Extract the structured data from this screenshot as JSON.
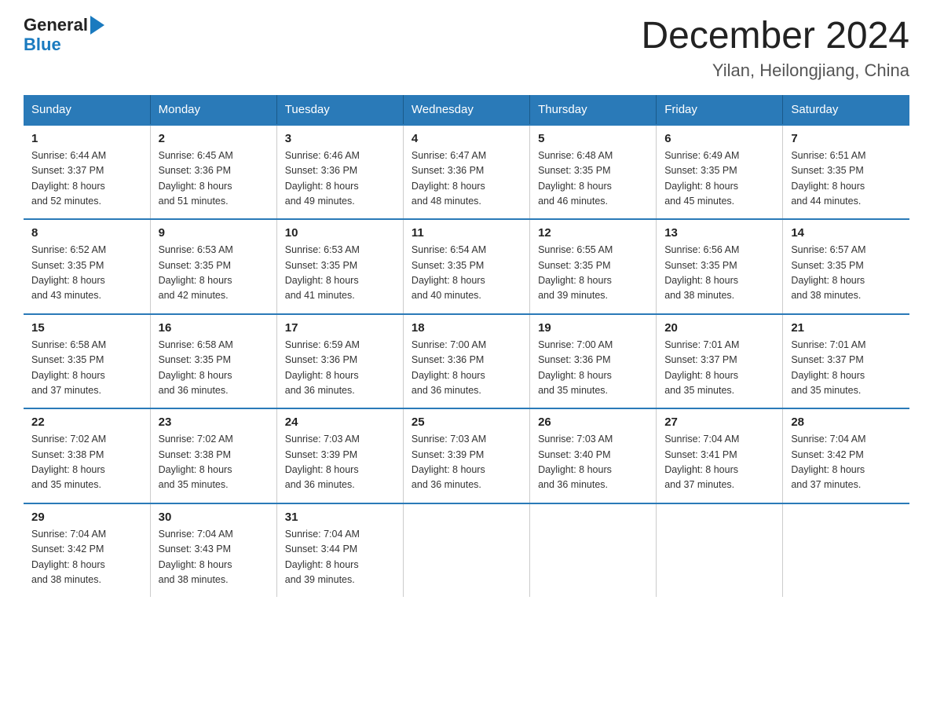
{
  "header": {
    "logo_general": "General",
    "logo_blue": "Blue",
    "title": "December 2024",
    "subtitle": "Yilan, Heilongjiang, China"
  },
  "days_of_week": [
    "Sunday",
    "Monday",
    "Tuesday",
    "Wednesday",
    "Thursday",
    "Friday",
    "Saturday"
  ],
  "weeks": [
    [
      {
        "day": "1",
        "sunrise": "6:44 AM",
        "sunset": "3:37 PM",
        "daylight": "8 hours and 52 minutes."
      },
      {
        "day": "2",
        "sunrise": "6:45 AM",
        "sunset": "3:36 PM",
        "daylight": "8 hours and 51 minutes."
      },
      {
        "day": "3",
        "sunrise": "6:46 AM",
        "sunset": "3:36 PM",
        "daylight": "8 hours and 49 minutes."
      },
      {
        "day": "4",
        "sunrise": "6:47 AM",
        "sunset": "3:36 PM",
        "daylight": "8 hours and 48 minutes."
      },
      {
        "day": "5",
        "sunrise": "6:48 AM",
        "sunset": "3:35 PM",
        "daylight": "8 hours and 46 minutes."
      },
      {
        "day": "6",
        "sunrise": "6:49 AM",
        "sunset": "3:35 PM",
        "daylight": "8 hours and 45 minutes."
      },
      {
        "day": "7",
        "sunrise": "6:51 AM",
        "sunset": "3:35 PM",
        "daylight": "8 hours and 44 minutes."
      }
    ],
    [
      {
        "day": "8",
        "sunrise": "6:52 AM",
        "sunset": "3:35 PM",
        "daylight": "8 hours and 43 minutes."
      },
      {
        "day": "9",
        "sunrise": "6:53 AM",
        "sunset": "3:35 PM",
        "daylight": "8 hours and 42 minutes."
      },
      {
        "day": "10",
        "sunrise": "6:53 AM",
        "sunset": "3:35 PM",
        "daylight": "8 hours and 41 minutes."
      },
      {
        "day": "11",
        "sunrise": "6:54 AM",
        "sunset": "3:35 PM",
        "daylight": "8 hours and 40 minutes."
      },
      {
        "day": "12",
        "sunrise": "6:55 AM",
        "sunset": "3:35 PM",
        "daylight": "8 hours and 39 minutes."
      },
      {
        "day": "13",
        "sunrise": "6:56 AM",
        "sunset": "3:35 PM",
        "daylight": "8 hours and 38 minutes."
      },
      {
        "day": "14",
        "sunrise": "6:57 AM",
        "sunset": "3:35 PM",
        "daylight": "8 hours and 38 minutes."
      }
    ],
    [
      {
        "day": "15",
        "sunrise": "6:58 AM",
        "sunset": "3:35 PM",
        "daylight": "8 hours and 37 minutes."
      },
      {
        "day": "16",
        "sunrise": "6:58 AM",
        "sunset": "3:35 PM",
        "daylight": "8 hours and 36 minutes."
      },
      {
        "day": "17",
        "sunrise": "6:59 AM",
        "sunset": "3:36 PM",
        "daylight": "8 hours and 36 minutes."
      },
      {
        "day": "18",
        "sunrise": "7:00 AM",
        "sunset": "3:36 PM",
        "daylight": "8 hours and 36 minutes."
      },
      {
        "day": "19",
        "sunrise": "7:00 AM",
        "sunset": "3:36 PM",
        "daylight": "8 hours and 35 minutes."
      },
      {
        "day": "20",
        "sunrise": "7:01 AM",
        "sunset": "3:37 PM",
        "daylight": "8 hours and 35 minutes."
      },
      {
        "day": "21",
        "sunrise": "7:01 AM",
        "sunset": "3:37 PM",
        "daylight": "8 hours and 35 minutes."
      }
    ],
    [
      {
        "day": "22",
        "sunrise": "7:02 AM",
        "sunset": "3:38 PM",
        "daylight": "8 hours and 35 minutes."
      },
      {
        "day": "23",
        "sunrise": "7:02 AM",
        "sunset": "3:38 PM",
        "daylight": "8 hours and 35 minutes."
      },
      {
        "day": "24",
        "sunrise": "7:03 AM",
        "sunset": "3:39 PM",
        "daylight": "8 hours and 36 minutes."
      },
      {
        "day": "25",
        "sunrise": "7:03 AM",
        "sunset": "3:39 PM",
        "daylight": "8 hours and 36 minutes."
      },
      {
        "day": "26",
        "sunrise": "7:03 AM",
        "sunset": "3:40 PM",
        "daylight": "8 hours and 36 minutes."
      },
      {
        "day": "27",
        "sunrise": "7:04 AM",
        "sunset": "3:41 PM",
        "daylight": "8 hours and 37 minutes."
      },
      {
        "day": "28",
        "sunrise": "7:04 AM",
        "sunset": "3:42 PM",
        "daylight": "8 hours and 37 minutes."
      }
    ],
    [
      {
        "day": "29",
        "sunrise": "7:04 AM",
        "sunset": "3:42 PM",
        "daylight": "8 hours and 38 minutes."
      },
      {
        "day": "30",
        "sunrise": "7:04 AM",
        "sunset": "3:43 PM",
        "daylight": "8 hours and 38 minutes."
      },
      {
        "day": "31",
        "sunrise": "7:04 AM",
        "sunset": "3:44 PM",
        "daylight": "8 hours and 39 minutes."
      },
      null,
      null,
      null,
      null
    ]
  ],
  "labels": {
    "sunrise": "Sunrise:",
    "sunset": "Sunset:",
    "daylight": "Daylight:"
  }
}
